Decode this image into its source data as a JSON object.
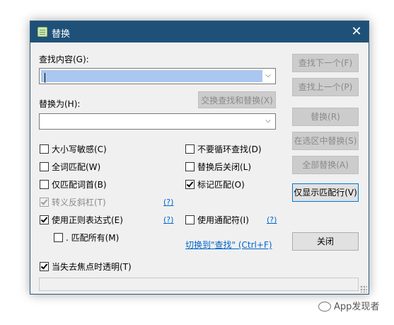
{
  "window": {
    "title": "替换",
    "close_glyph": "✕"
  },
  "find": {
    "label": "查找内容(G):",
    "value": ""
  },
  "replace": {
    "label": "替换为(H):",
    "value": ""
  },
  "buttons": {
    "find_next": "查找下一个(F)",
    "find_prev": "查找上一个(P)",
    "swap": "交换查找和替换(X)",
    "replace": "替换(R)",
    "replace_in_selection": "在选区中替换(S)",
    "replace_all": "全部替换(A)",
    "show_matches": "仅显示匹配行(V)",
    "close": "关闭"
  },
  "options_left": [
    {
      "label": "大小写敏感(C)",
      "checked": false,
      "disabled": false
    },
    {
      "label": "全词匹配(W)",
      "checked": false,
      "disabled": false
    },
    {
      "label": "仅匹配词首(B)",
      "checked": false,
      "disabled": false
    },
    {
      "label": "转义反斜杠(T)",
      "checked": true,
      "disabled": true
    },
    {
      "label": "使用正则表达式(E)",
      "checked": true,
      "disabled": false
    },
    {
      "label": ". 匹配所有(M)",
      "checked": false,
      "disabled": false
    }
  ],
  "options_right": [
    {
      "label": "不要循环查找(D)",
      "checked": false
    },
    {
      "label": "替换后关闭(L)",
      "checked": false
    },
    {
      "label": "标记匹配(O)",
      "checked": true
    },
    {
      "label": "使用通配符(I)",
      "checked": false
    }
  ],
  "help_links": {
    "escape": "(?)",
    "regex": "(?)",
    "wildcard": "(?)"
  },
  "switch_link": "切换到\"查找\" (Ctrl+F)",
  "transparent_option": {
    "label": "当失去焦点时透明(T)",
    "checked": true
  },
  "watermark": "App发现者",
  "colors": {
    "titlebar": "#1f5178",
    "selection": "#a9c7ef",
    "link": "#0066cc"
  }
}
